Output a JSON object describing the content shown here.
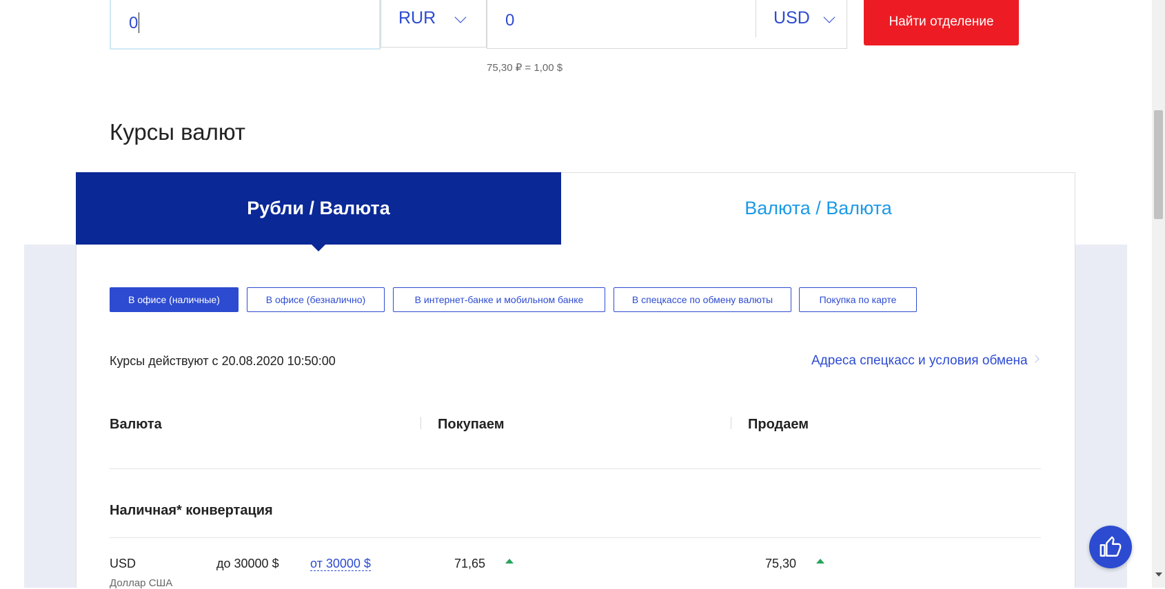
{
  "converter": {
    "amount_from": "0",
    "currency_from": "RUR",
    "amount_to": "0",
    "currency_to": "USD",
    "find_button": "Найти отделение",
    "rate_note": "75,30 ₽ = 1,00 $"
  },
  "section_title": "Курсы валют",
  "tabs": [
    {
      "label": "Рубли / Валюта",
      "active": true
    },
    {
      "label": "Валюта / Валюта",
      "active": false
    }
  ],
  "chips": [
    {
      "label": "В офисе (наличные)",
      "active": true
    },
    {
      "label": "В офисе (безналично)",
      "active": false
    },
    {
      "label": "В интернет-банке и мобильном банке",
      "active": false
    },
    {
      "label": "В спецкассе по обмену валюты",
      "active": false
    },
    {
      "label": "Покупка по карте",
      "active": false
    }
  ],
  "valid_from": "Курсы действуют с 20.08.2020 10:50:00",
  "addresses_link": "Адреса спецкасс и условия обмена",
  "table": {
    "headers": [
      "Валюта",
      "Покупаем",
      "Продаем"
    ],
    "group_title": "Наличная* конвертация",
    "rows": [
      {
        "code": "USD",
        "name": "Доллар США",
        "range_1": "до 30000 $",
        "range_2": "от 30000 $",
        "buy": "71,65",
        "sell": "75,30"
      }
    ]
  },
  "colors": {
    "primary": "#0a2896",
    "link": "#2d4bd0",
    "accent_red": "#ed1c24",
    "up_green": "#26a55a",
    "tab_inactive": "#1b9ae6"
  },
  "icons": {
    "feedback": "thumbs-up-icon",
    "trend": "arrow-up-icon"
  }
}
